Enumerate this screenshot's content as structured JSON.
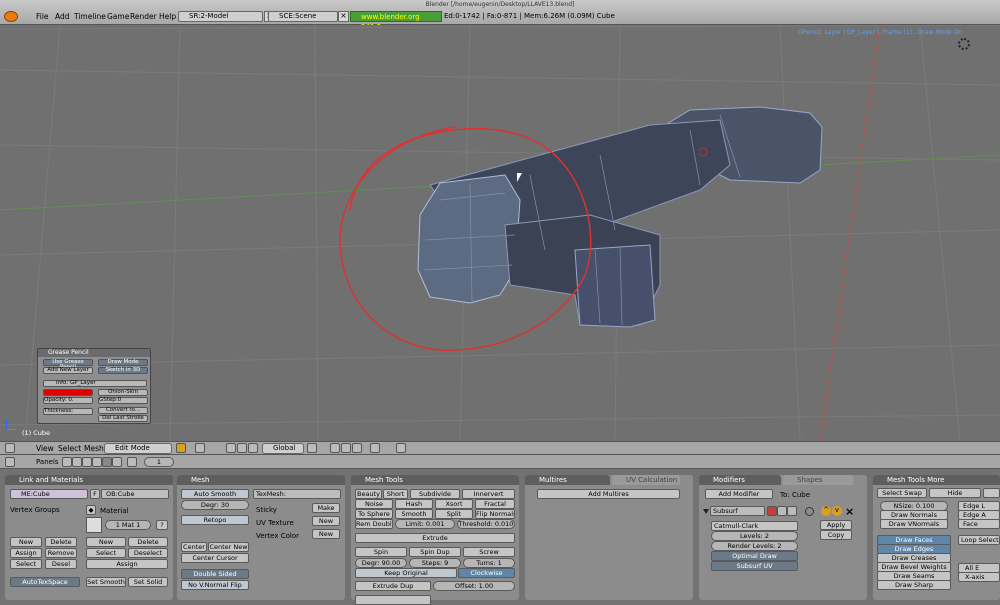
{
  "topbar": {
    "title": "Blender [/home/eugenin/Desktop/LLAVE13.blend]",
    "menus": [
      "File",
      "Add",
      "Timeline",
      "Game",
      "Render",
      "Help"
    ],
    "screen": "SR:2-Model",
    "scene": "SCE:Scene",
    "url": "www.blender.org 249.2",
    "stats": "Ed:0-1742 | Fa:0-871 | Mem:6.26M (0.09M) Cube"
  },
  "viewport": {
    "info": "GPencil: Layer ('GP_Layer'), Frame (1) , Draw Mode On",
    "object_label": "(1) Cube"
  },
  "grease_pencil": {
    "title": "Grease Pencil",
    "use_btn": "Use Grease Pencil",
    "add_layer": "Add New Layer",
    "draw_mode": "Draw Mode",
    "sketch_3d": "Sketch in 3D",
    "layer_name": "Info: GP_Layer",
    "onion_skin": "Onion-Skin",
    "opacity": "Opacity: 0.",
    "gstep": "GStep:0",
    "thickness": "Thickness:",
    "convert": "Convert to...",
    "del_last": "Del Last Stroke",
    "colors": {
      "stroke": "#e00000"
    }
  },
  "viewheader": {
    "menus": [
      "View",
      "Select",
      "Mesh"
    ],
    "mode": "Edit Mode",
    "orientation": "Global"
  },
  "buttonsheader": {
    "panels_label": "Panels",
    "frame": "1"
  },
  "link_materials": {
    "title": "Link and Materials",
    "mesh": "ME:Cube",
    "f": "F",
    "object": "OB:Cube",
    "vertex_groups": "Vertex Groups",
    "material": "Material",
    "mat_count": "1 Mat 1",
    "q": "?",
    "new": "New",
    "delete": "Delete",
    "assign": "Assign",
    "remove": "Remove",
    "select": "Select",
    "deselect": "Deselect",
    "desel": "Desel",
    "autotexspace": "AutoTexSpace",
    "set_smooth": "Set Smooth",
    "set_solid": "Set Solid"
  },
  "mesh": {
    "title": "Mesh",
    "auto_smooth": "Auto Smooth",
    "degr": "Degr: 30",
    "retopo": "Retopo",
    "center": "Center",
    "center_new": "Center New",
    "center_cursor": "Center Cursor",
    "double_sided": "Double Sided",
    "no_vnormal_flip": "No V.Normal Flip",
    "texmesh": "TexMesh:",
    "sticky": "Sticky",
    "make": "Make",
    "uv_texture": "UV Texture",
    "new": "New",
    "vertex_color": "Vertex Color"
  },
  "mesh_tools": {
    "title": "Mesh Tools",
    "row1": [
      "Beauty",
      "Short",
      "Subdivide",
      "Innervert"
    ],
    "row2": [
      "Noise",
      "Hash",
      "Xsort",
      "Fractal"
    ],
    "row3": [
      "To Sphere",
      "Smooth",
      "Split",
      "Flip Normals"
    ],
    "rem_double": "Rem Double",
    "limit": "Limit: 0.001",
    "threshold": "Threshold: 0.010",
    "extrude": "Extrude",
    "spin": "Spin",
    "spin_dup": "Spin Dup",
    "screw": "Screw",
    "degr": "Degr: 90.00",
    "steps": "Steps: 9",
    "turns": "Turns: 1",
    "keep_original": "Keep Original",
    "clockwise": "Clockwise",
    "extrude_dup": "Extrude Dup",
    "offset": "Offset: 1.00"
  },
  "multires": {
    "tab1": "Multires",
    "tab2": "UV Calculation",
    "add": "Add Multires"
  },
  "modifiers": {
    "tab1": "Modifiers",
    "tab2": "Shapes",
    "add": "Add Modifier",
    "to": "To: Cube",
    "name": "Subsurf",
    "type": "Catmull-Clark",
    "levels": "Levels: 2",
    "render_levels": "Render Levels: 2",
    "optimal_draw": "Optimal Draw",
    "subsurf_uv": "Subsurf UV",
    "apply": "Apply",
    "copy": "Copy"
  },
  "mesh_tools_more": {
    "title": "Mesh Tools More",
    "select_swap": "Select Swap",
    "hide": "Hide",
    "nsize": "NSize: 0.100",
    "draw_normals": "Draw Normals",
    "draw_vnormals": "Draw VNormals",
    "draw_faces": "Draw Faces",
    "draw_edges": "Draw Edges",
    "draw_creases": "Draw Creases",
    "draw_bevel_weights": "Draw Bevel Weights",
    "draw_seams": "Draw Seams",
    "draw_sharp": "Draw Sharp",
    "edge_l": "Edge L",
    "edge_a": "Edge A",
    "face": "Face",
    "loop_select": "Loop Select",
    "all_e": "All E",
    "x_axis": "X-axis"
  }
}
